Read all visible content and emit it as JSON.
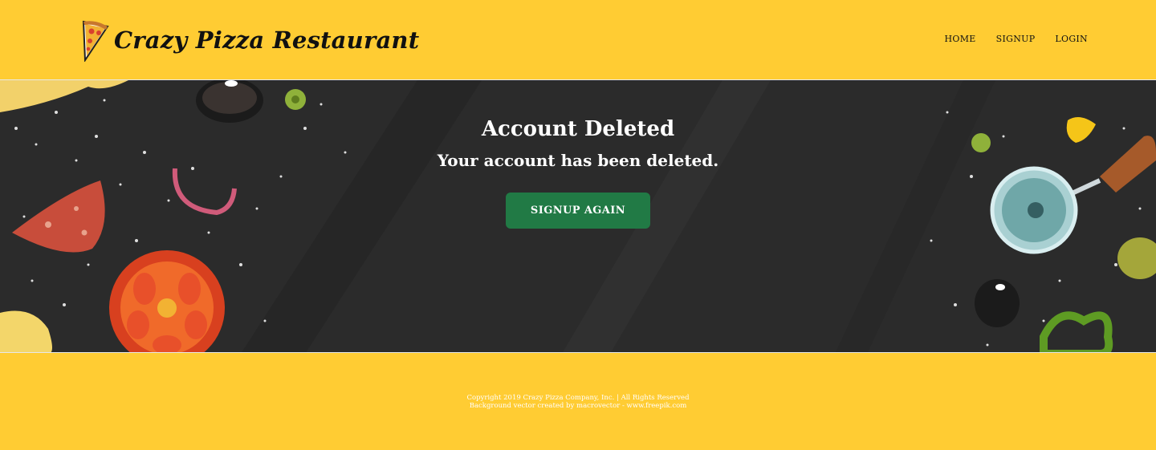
{
  "header": {
    "brand_icon": "pizza-slice-icon",
    "brand_title": "Crazy Pizza Restaurant",
    "nav": [
      "HOME",
      "SIGNUP",
      "LOGIN"
    ]
  },
  "hero": {
    "title": "Account Deleted",
    "subtitle": "Your account has been deleted.",
    "cta_label": "SIGNUP AGAIN"
  },
  "footer": {
    "copyright": "Copyright 2019 Crazy Pizza Company, Inc. | All Rights Reserved",
    "credit": "Background vector created by macrovector - www.freepik.com"
  },
  "colors": {
    "brand_yellow": "#ffcc33",
    "hero_background": "#2a2a2a",
    "button_green": "#217a45"
  }
}
